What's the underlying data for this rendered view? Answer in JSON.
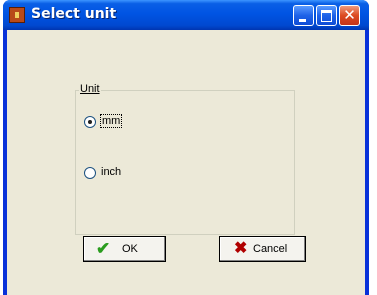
{
  "window": {
    "title": "Select unit"
  },
  "unit_group": {
    "label": "Unit",
    "options": [
      {
        "label": "mm",
        "checked": true
      },
      {
        "label": "inch",
        "checked": false
      }
    ]
  },
  "buttons": {
    "ok_label": "OK",
    "cancel_label": "Cancel"
  },
  "icons": {
    "app": "app-icon",
    "ok": "check-icon",
    "cancel": "x-icon"
  }
}
